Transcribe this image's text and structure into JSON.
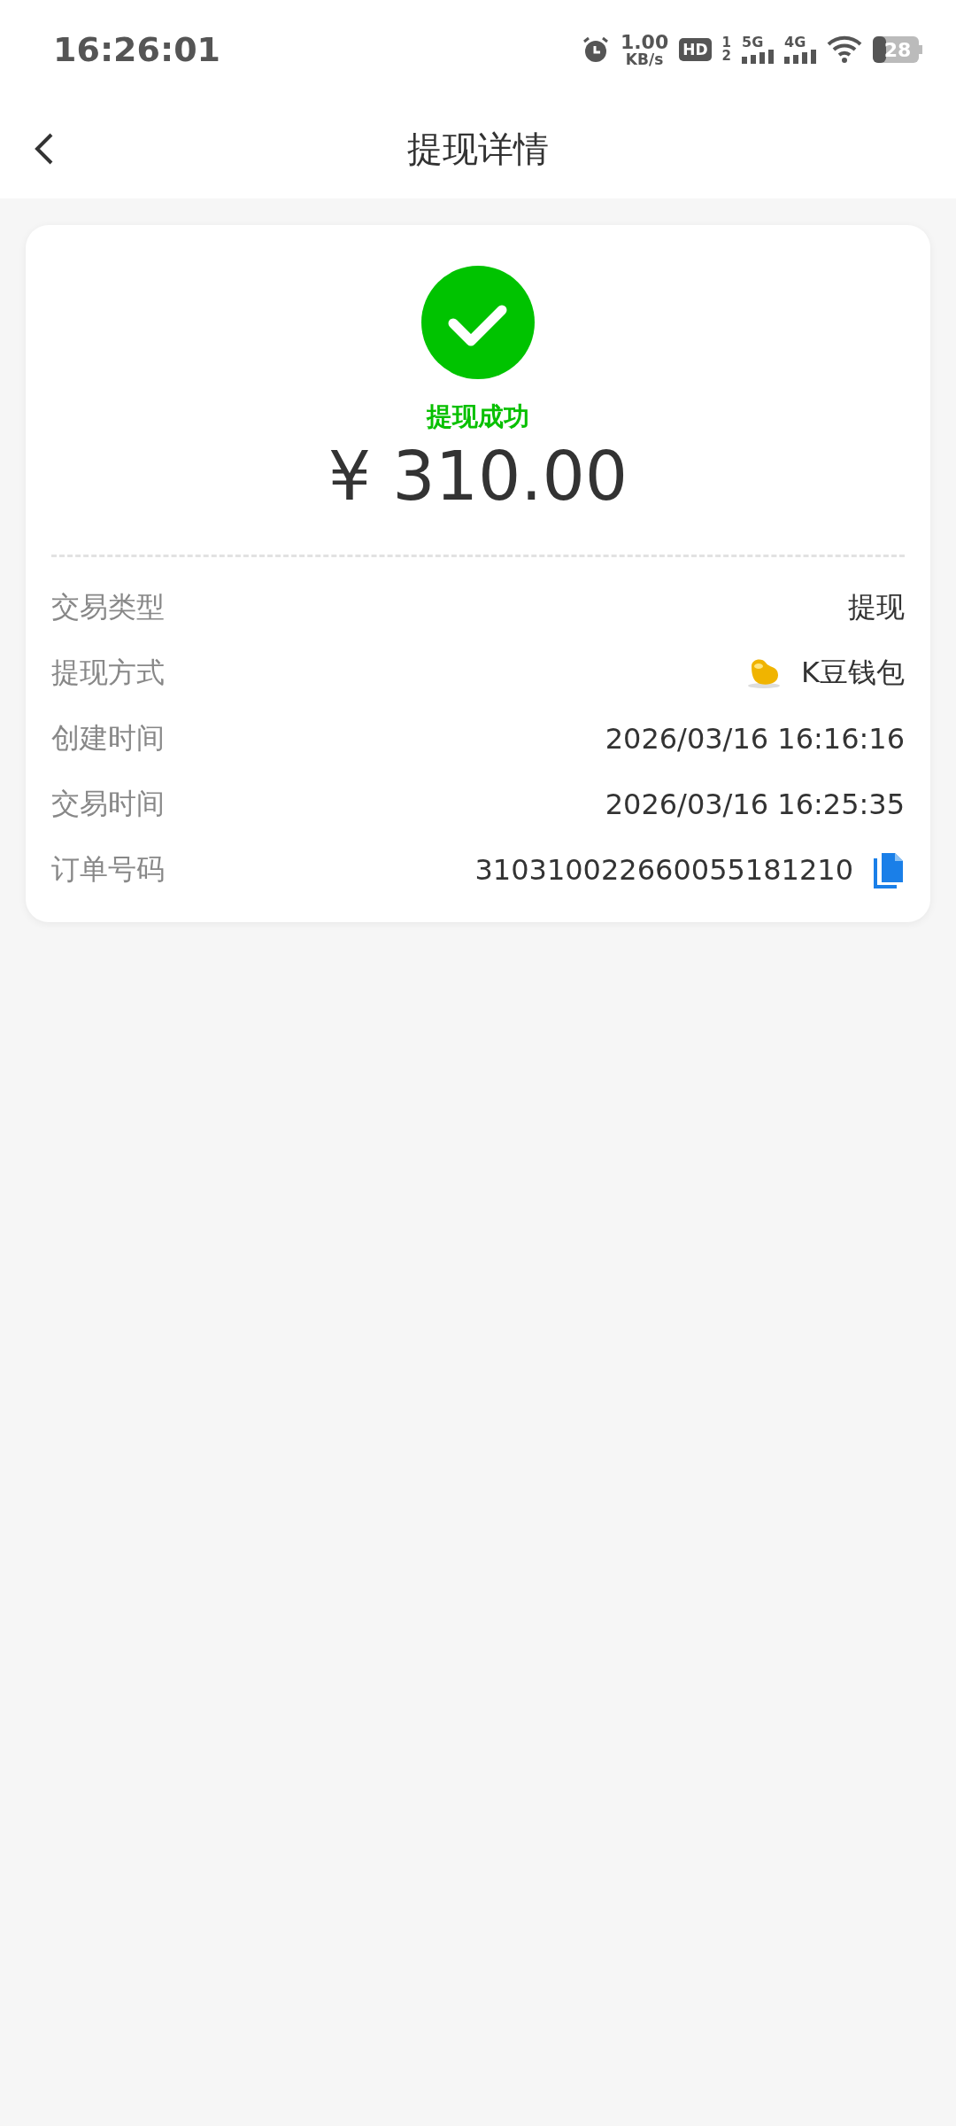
{
  "status_bar": {
    "time": "16:26:01",
    "speed_value": "1.00",
    "speed_unit": "KB/s",
    "hd": "HD",
    "sim_1": "1",
    "sim_2": "2",
    "network_1": "5G",
    "network_2": "4G",
    "battery": "28"
  },
  "header": {
    "title": "提现详情"
  },
  "result": {
    "status": "提现成功",
    "amount": "¥ 310.00"
  },
  "details": [
    {
      "kind": "text",
      "label": "交易类型",
      "value": "提现"
    },
    {
      "kind": "wallet",
      "label": "提现方式",
      "value": "K豆钱包"
    },
    {
      "kind": "text",
      "label": "创建时间",
      "value": "2026/03/16 16:16:16"
    },
    {
      "kind": "text",
      "label": "交易时间",
      "value": "2026/03/16 16:25:35"
    },
    {
      "kind": "copy",
      "label": "订单号码",
      "value": "310310022660055181210"
    }
  ]
}
